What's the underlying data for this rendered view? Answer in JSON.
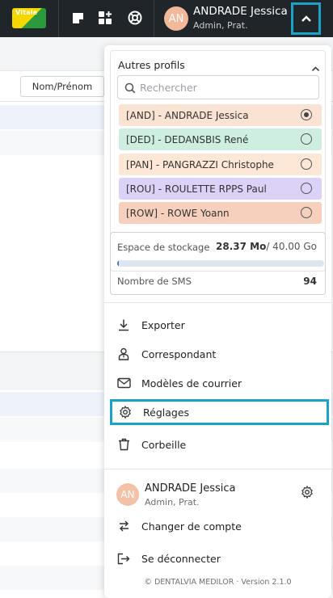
{
  "topbar": {
    "vitale_label": "Vitale",
    "user_initials": "AN",
    "user_name": "ANDRADE Jessica",
    "user_role": "Admin, Prat."
  },
  "background": {
    "sort_tab_label": "Nom/Prénom"
  },
  "profiles": {
    "title": "Autres profils",
    "search_placeholder": "Rechercher",
    "items": [
      {
        "label": "[AND] - ANDRADE Jessica",
        "color": "#fbe3d3",
        "selected": true
      },
      {
        "label": "[DED] - DEDANSBIS René",
        "color": "#cdeee0",
        "selected": false
      },
      {
        "label": "[PAN] - PANGRAZZI Christophe",
        "color": "#fde7d6",
        "selected": false
      },
      {
        "label": "[ROU] - ROULETTE RPPS Paul",
        "color": "#dcd2f7",
        "selected": false
      },
      {
        "label": "[ROW] - ROWE Yoann",
        "color": "#f7d0bd",
        "selected": false
      }
    ]
  },
  "storage": {
    "label": "Espace de stockage",
    "used": "28.37 Mo",
    "total": "/ 40.00 Go",
    "used_fraction": 0.0007,
    "sms_label": "Nombre de SMS",
    "sms_value": "94"
  },
  "menu": {
    "items": [
      {
        "label": "Exporter",
        "icon": "download-icon"
      },
      {
        "label": "Correspondant",
        "icon": "contact-icon"
      },
      {
        "label": "Modèles de courrier",
        "icon": "mail-icon"
      },
      {
        "label": "Réglages",
        "icon": "gear-icon",
        "highlighted": true
      },
      {
        "label": "Corbeille",
        "icon": "trash-icon"
      }
    ]
  },
  "account": {
    "initials": "AN",
    "name": "ANDRADE Jessica",
    "role": "Admin, Prat.",
    "switch_label": "Changer de compte",
    "logout_label": "Se déconnecter"
  },
  "footer": "© DENTALVIA MEDILOR · Version 2.1.0",
  "colors": {
    "topbar": "#20252a",
    "highlight": "#19a3c9",
    "avatar": "#f3b79a",
    "storage_bar": "#4a78b8"
  }
}
